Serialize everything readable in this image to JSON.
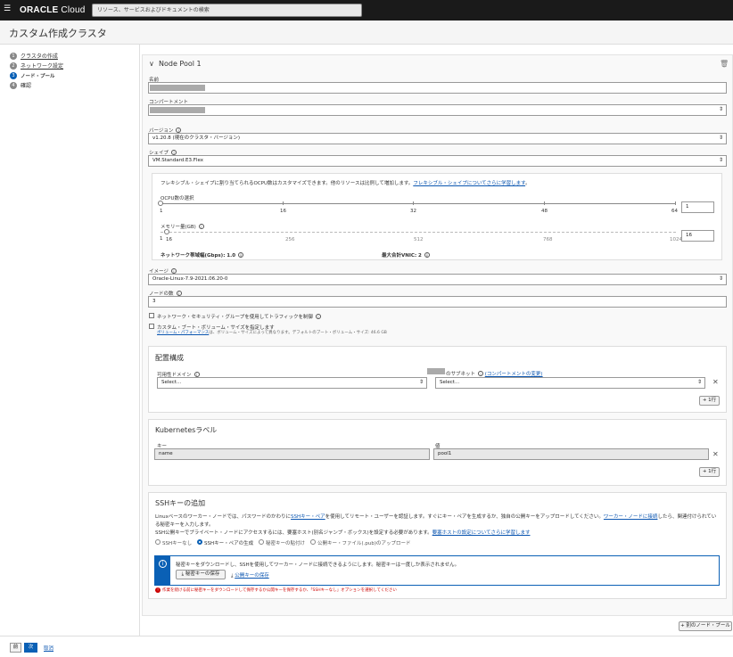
{
  "header": {
    "brand_bold": "ORACLE",
    "brand_light": " Cloud",
    "search_placeholder": "リソース、サービスおよびドキュメントの検索"
  },
  "page_title": "カスタム作成クラスタ",
  "steps": [
    {
      "num": "1",
      "label": "クラスタの作成"
    },
    {
      "num": "2",
      "label": "ネットワーク設定"
    },
    {
      "num": "3",
      "label": "ノード・プール"
    },
    {
      "num": "4",
      "label": "確認"
    }
  ],
  "pool": {
    "title": "Node Pool 1",
    "name_label": "名前",
    "compartment_label": "コンパートメント",
    "version_label": "バージョン",
    "version_value": "v1.20.8 (現在のクラスタ・バージョン)",
    "shape_label": "シェイプ",
    "shape_value": "VM.Standard.E3.Flex",
    "flex_text": "フレキシブル・シェイプに割り当てられるOCPU数はカスタマイズできます。他のリソースは比例して増加します。",
    "flex_link": "フレキシブル・シェイプについてさらに学習します",
    "ocpu_label": "OCPU数の選択",
    "ocpu_ticks": [
      "1",
      "16",
      "32",
      "48",
      "64"
    ],
    "ocpu_value": "1",
    "memory_label": "メモリー量(GB)",
    "memory_ticks_left": [
      "1",
      "16"
    ],
    "memory_ticks": [
      "256",
      "512",
      "768",
      "1024"
    ],
    "memory_value": "16",
    "network_bw": "ネットワーク帯域幅(Gbps): 1.0",
    "max_vnic": "最大合計VNIC: 2",
    "image_label": "イメージ",
    "image_value": "Oracle-Linux-7.9-2021.06.20-0",
    "node_count_label": "ノードの数",
    "node_count_value": "3",
    "nsg_label": "ネットワーク・セキュリティ・グループを使用してトラフィックを制御",
    "boot_label": "カスタム・ブート・ボリューム・サイズを指定します",
    "boot_link": "ボリューム・パフォーマンス",
    "boot_help": "は、ボリューム・サイズによって異なります。デフォルトのブート・ボリューム・サイズ: 46.6 GB"
  },
  "placement": {
    "title": "配置構成",
    "ad_label": "可用性ドメイン",
    "ad_placeholder": "Select...",
    "subnet_label": "のサブネット",
    "subnet_link": "(コンパートメントの変更)",
    "subnet_placeholder": "Select...",
    "add_row": "+ 1行"
  },
  "labels": {
    "title": "Kubernetesラベル",
    "key_label": "キー",
    "key_value": "name",
    "value_label": "値",
    "value_value": "pool1",
    "add_row": "+ 1行"
  },
  "ssh": {
    "title": "SSHキーの追加",
    "desc1a": "Linuxベースのワーカー・ノードでは、パスワードのかわりに",
    "desc1_link": "SSHキー・ペア",
    "desc1b": "を使用してリモート・ユーザーを認証します。すぐにキー・ペアを生成するか、独自の公開キーをアップロードしてください。",
    "desc1_link2": "ワーカー・ノードに接続",
    "desc1c": "したら、関連付けられている秘密キーを入力します。",
    "desc2a": "SSH公開キーでプライベート・ノードにアクセスするには、要塞ホスト(別名ジャンプ・ボックス)を設定する必要があります。",
    "desc2_link": "要塞ホストの設定についてさらに学習します",
    "options": [
      "SSHキーなし",
      "SSHキー・ペアの生成",
      "秘密キーの貼付け",
      "公開キー・ファイル(.pub)のアップロード"
    ],
    "notice": "秘密キーをダウンロードし、SSHを使用してワーカー・ノードに接続できるようにします。秘密キーは一度しか表示されません。",
    "save_private": "秘密キーの保存",
    "save_public": "公開キーの保存",
    "error": "作業を続ける前に秘密キーをダウンロードして保存するか公開キーを保存するか、「SSHキーなし」オプションを選択してください"
  },
  "add_pool": "+ 別のノード・プール",
  "footer": {
    "prev": "前",
    "next": "次",
    "cancel": "取消"
  }
}
